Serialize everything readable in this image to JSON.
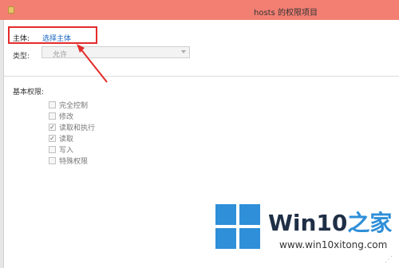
{
  "window": {
    "title": "hosts 的权限项目"
  },
  "principal": {
    "label": "主体:",
    "link": "选择主体"
  },
  "type": {
    "label": "类型:",
    "value": "允许"
  },
  "permissions": {
    "title": "基本权限:",
    "items": [
      {
        "label": "完全控制",
        "checked": false
      },
      {
        "label": "修改",
        "checked": false
      },
      {
        "label": "读取和执行",
        "checked": true
      },
      {
        "label": "读取",
        "checked": true
      },
      {
        "label": "写入",
        "checked": false
      },
      {
        "label": "特殊权限",
        "checked": false
      }
    ]
  },
  "branding": {
    "name_part1": "Win10",
    "name_part2": "之家",
    "url": "www.win10xitong.com"
  },
  "colors": {
    "titlebar": "#f27f72",
    "highlight_box": "#e52b2b",
    "link": "#1a66c2",
    "logo_blue": "#2f8fd8"
  }
}
